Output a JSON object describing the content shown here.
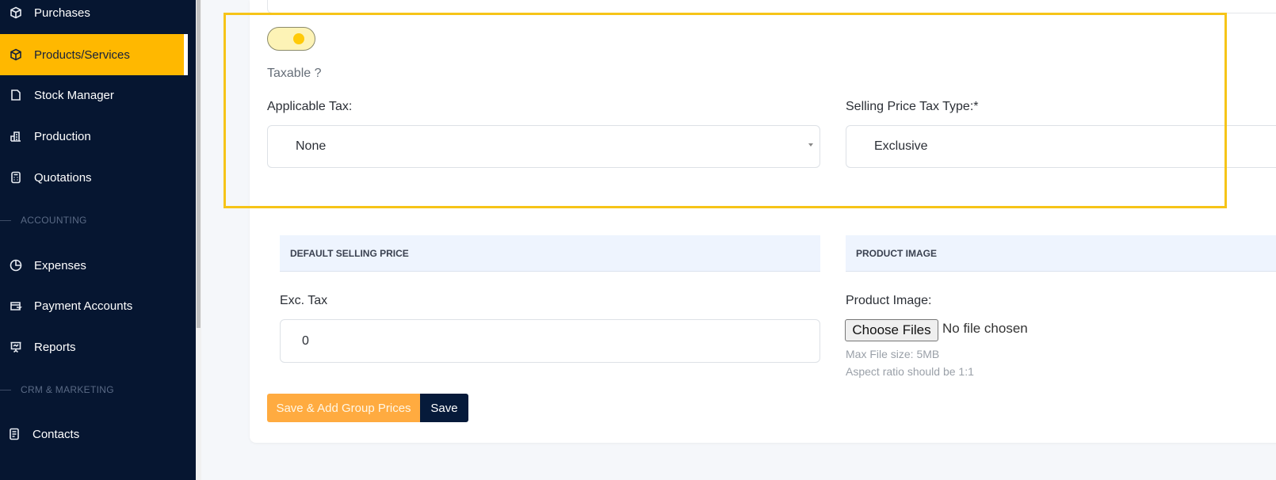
{
  "sidebar": {
    "items": [
      {
        "label": "Purchases",
        "icon": "box-icon"
      },
      {
        "label": "Products/Services",
        "icon": "cube-icon",
        "active": true
      },
      {
        "label": "Stock Manager",
        "icon": "folder-icon"
      },
      {
        "label": "Production",
        "icon": "factory-icon"
      },
      {
        "label": "Quotations",
        "icon": "calculator-icon"
      },
      {
        "label": "Expenses",
        "icon": "pie-chart-icon"
      },
      {
        "label": "Payment Accounts",
        "icon": "wallet-icon"
      },
      {
        "label": "Reports",
        "icon": "presentation-icon"
      },
      {
        "label": "Contacts",
        "icon": "contacts-icon"
      }
    ],
    "sections": {
      "accounting": "ACCOUNTING",
      "crm": "CRM & MARKETING"
    },
    "accent_color": "#ffb800",
    "background_color": "#061631"
  },
  "form": {
    "taxable_toggle": {
      "label": "Taxable ?",
      "checked": true
    },
    "applicable_tax": {
      "label": "Applicable Tax:",
      "value": "None"
    },
    "selling_price_tax_type": {
      "label": "Selling Price Tax Type:*",
      "value": "Exclusive"
    },
    "default_selling_price": {
      "heading": "DEFAULT SELLING PRICE",
      "exc_tax_label": "Exc. Tax",
      "exc_tax_value": "0"
    },
    "product_image": {
      "heading": "PRODUCT IMAGE",
      "label": "Product Image:",
      "choose_button": "Choose Files",
      "status": "No file chosen",
      "hint_size": "Max File size: 5MB",
      "hint_ratio": "Aspect ratio should be 1:1"
    }
  },
  "actions": {
    "save_add_group_prices": "Save & Add Group Prices",
    "save": "Save"
  },
  "highlight_color": "#f6c418"
}
